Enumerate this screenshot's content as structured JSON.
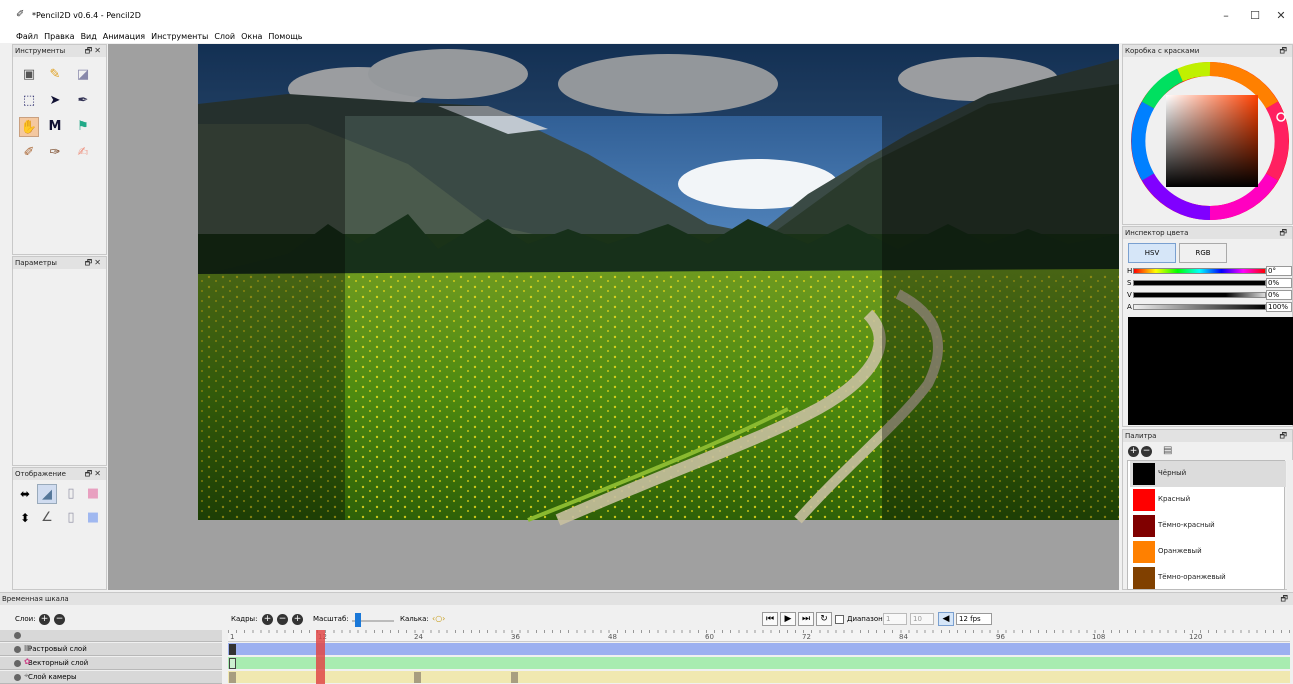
{
  "window": {
    "title": "*Pencil2D v0.6.4 - Pencil2D",
    "min": "–",
    "max": "☐",
    "close": "✕"
  },
  "menu": [
    "Файл",
    "Правка",
    "Вид",
    "Анимация",
    "Инструменты",
    "Слой",
    "Окна",
    "Помощь"
  ],
  "panels": {
    "tools": {
      "title": "Инструменты"
    },
    "options": {
      "title": "Параметры"
    },
    "display": {
      "title": "Отображение"
    },
    "colorbox": {
      "title": "Коробка с красками"
    },
    "inspector": {
      "title": "Инспектор цвета",
      "tab_hsv": "HSV",
      "tab_rgb": "RGB",
      "labels": {
        "h": "H",
        "s": "S",
        "v": "V",
        "a": "A"
      },
      "values": {
        "h": "0°",
        "s": "0%",
        "v": "0%",
        "a": "100%"
      },
      "preview_color": "#000000"
    },
    "palette": {
      "title": "Палитра",
      "items": [
        {
          "name": "Чёрный",
          "color": "#000000"
        },
        {
          "name": "Красный",
          "color": "#ff0000"
        },
        {
          "name": "Тёмно-красный",
          "color": "#800000"
        },
        {
          "name": "Оранжевый",
          "color": "#ff8000"
        },
        {
          "name": "Тёмно-оранжевый",
          "color": "#804000"
        }
      ]
    }
  },
  "timeline": {
    "title": "Временная шкала",
    "layers_label": "Слои:",
    "frames_label": "Кадры:",
    "scale_label": "Масштаб:",
    "onion_label": "Калька:",
    "range_label": "Диапазон",
    "range_start": "1",
    "range_end": "10",
    "fps": "12 fps",
    "ruler": [
      "1",
      "12",
      "24",
      "36",
      "48",
      "60",
      "72",
      "84",
      "96",
      "108",
      "120"
    ],
    "current_frame": 12,
    "layers": [
      {
        "name": "Растровый слой",
        "color": "#9cb0f0"
      },
      {
        "name": "Векторный слой",
        "color": "#a8ecb0"
      },
      {
        "name": "Слой камеры",
        "color": "#f0e8b0"
      }
    ]
  }
}
